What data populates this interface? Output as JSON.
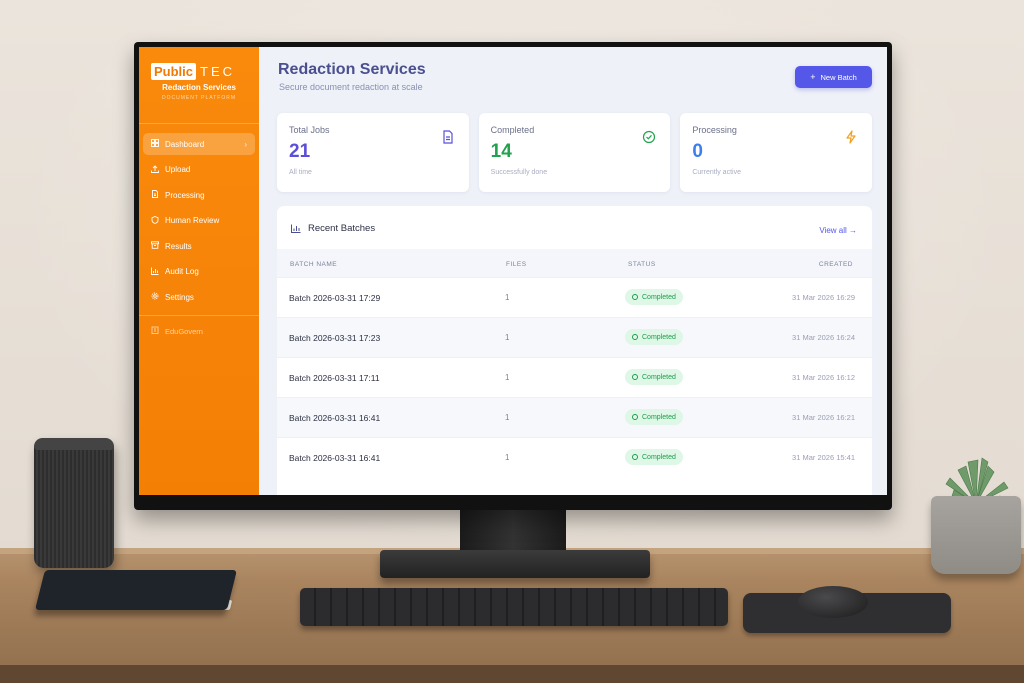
{
  "brand": {
    "logo_box": "Public",
    "logo_tec": "TEC",
    "name": "Redaction Services",
    "platform": "DOCUMENT PLATFORM"
  },
  "sidebar": {
    "items": [
      {
        "label": "Dashboard",
        "icon": "grid-icon",
        "active": true
      },
      {
        "label": "Upload",
        "icon": "upload-icon"
      },
      {
        "label": "Processing",
        "icon": "file-icon"
      },
      {
        "label": "Human Review",
        "icon": "shield-icon"
      },
      {
        "label": "Results",
        "icon": "archive-icon"
      },
      {
        "label": "Audit Log",
        "icon": "bar-chart-icon"
      },
      {
        "label": "Settings",
        "icon": "gear-icon"
      }
    ],
    "org": "EduGovern"
  },
  "header": {
    "title": "Redaction Services",
    "subtitle": "Secure document redaction at scale",
    "new_batch": "New Batch"
  },
  "cards": [
    {
      "label": "Total Jobs",
      "value": "21",
      "note": "All time",
      "color": "#5b4fd8",
      "icon": "document-icon"
    },
    {
      "label": "Completed",
      "value": "14",
      "note": "Successfully done",
      "color": "#22a24f",
      "icon": "check-circle-icon"
    },
    {
      "label": "Processing",
      "value": "0",
      "note": "Currently active",
      "color": "#3b7ef0",
      "icon": "lightning-icon"
    }
  ],
  "recent": {
    "title": "Recent Batches",
    "view_all": "View all →",
    "columns": [
      "BATCH NAME",
      "FILES",
      "STATUS",
      "CREATED"
    ],
    "rows": [
      {
        "name": "Batch 2026-03-31 17:29",
        "files": "1",
        "status": "Completed",
        "created": "31 Mar 2026 16:29"
      },
      {
        "name": "Batch 2026-03-31 17:23",
        "files": "1",
        "status": "Completed",
        "created": "31 Mar 2026 16:24"
      },
      {
        "name": "Batch 2026-03-31 17:11",
        "files": "1",
        "status": "Completed",
        "created": "31 Mar 2026 16:12"
      },
      {
        "name": "Batch 2026-03-31 16:41",
        "files": "1",
        "status": "Completed",
        "created": "31 Mar 2026 16:21"
      },
      {
        "name": "Batch 2026-03-31 16:41",
        "files": "1",
        "status": "Completed",
        "created": "31 Mar 2026 15:41"
      }
    ]
  },
  "colors": {
    "sidebar": "#f47f05",
    "accent": "#5457e8",
    "success": "#1d9b4b"
  }
}
